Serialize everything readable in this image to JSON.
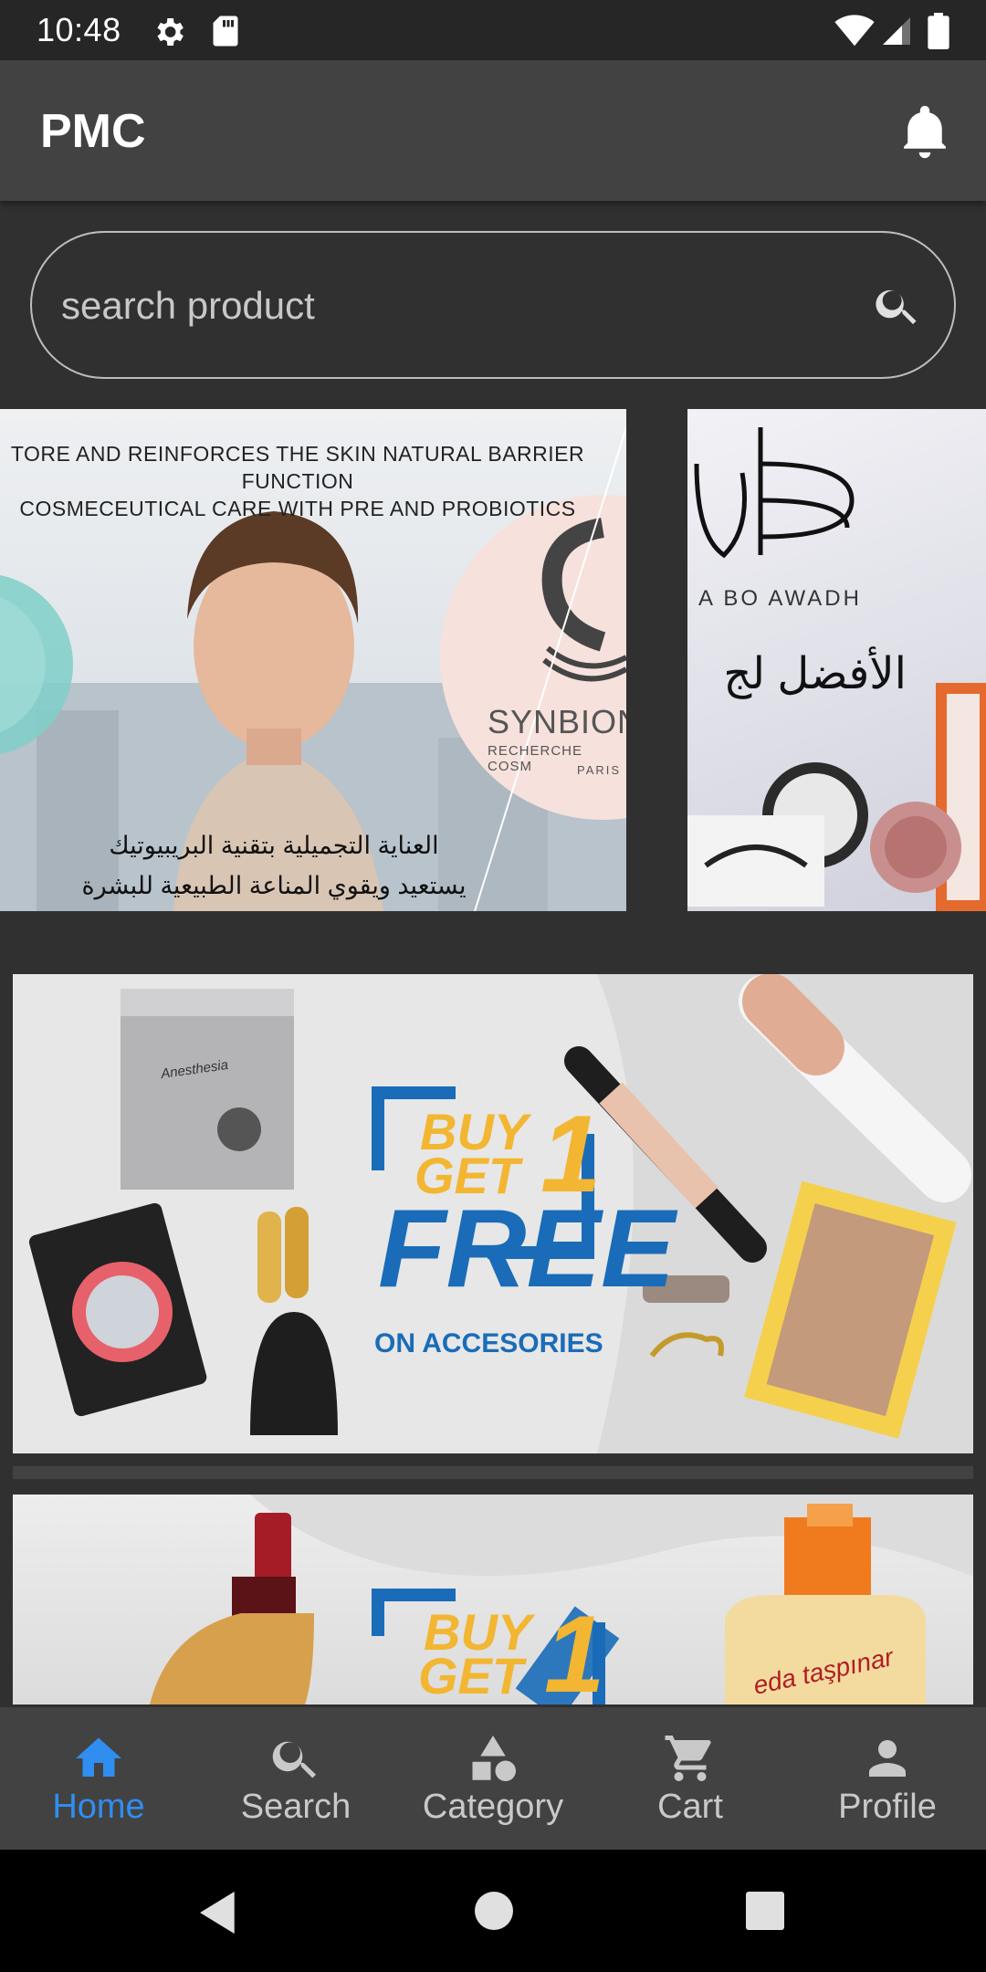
{
  "status_bar": {
    "time": "10:48",
    "icons": [
      "gear-icon",
      "sd-card-icon",
      "wifi-icon",
      "signal-icon",
      "battery-icon"
    ]
  },
  "app_bar": {
    "title": "PMC",
    "notification_icon": "bell-icon"
  },
  "search": {
    "placeholder": "search product",
    "icon": "search-icon"
  },
  "carousel": {
    "slides": [
      {
        "headline_line1": "TORE AND REINFORCES THE SKIN NATURAL BARRIER FUNCTION",
        "headline_line2": "COSMECEUTICAL CARE WITH PRE AND PROBIOTICS",
        "brand": "SYNBION",
        "brand_sub": "RECHERCHE COSM",
        "brand_city": "PARIS",
        "arabic_line1": "العناية التجميلية بتقنية البريبيوتيك",
        "arabic_line2": "يستعيد ويقوي المناعة الطبيعية للبشرة"
      },
      {
        "brand": "A BO AWADH",
        "arabic": "الأفضل لج"
      }
    ]
  },
  "banners": [
    {
      "buy": "BUY",
      "get": "GET",
      "one": "1",
      "free": "FREE",
      "subtitle": "ON ACCESORIES",
      "product_box": "Anesthesia"
    },
    {
      "buy": "BUY",
      "get": "GET",
      "one": "1",
      "product_label": "eda taşpınar"
    }
  ],
  "bottom_nav": {
    "items": [
      {
        "label": "Home",
        "icon": "home-icon",
        "active": true
      },
      {
        "label": "Search",
        "icon": "search-icon",
        "active": false
      },
      {
        "label": "Category",
        "icon": "category-icon",
        "active": false
      },
      {
        "label": "Cart",
        "icon": "cart-icon",
        "active": false
      },
      {
        "label": "Profile",
        "icon": "profile-icon",
        "active": false
      }
    ]
  },
  "colors": {
    "background": "#303030",
    "app_bar": "#424242",
    "active": "#2f8ef0",
    "inactive": "#c9c9c9",
    "promo_blue": "#1a6cb8",
    "promo_yellow": "#f2b632"
  }
}
